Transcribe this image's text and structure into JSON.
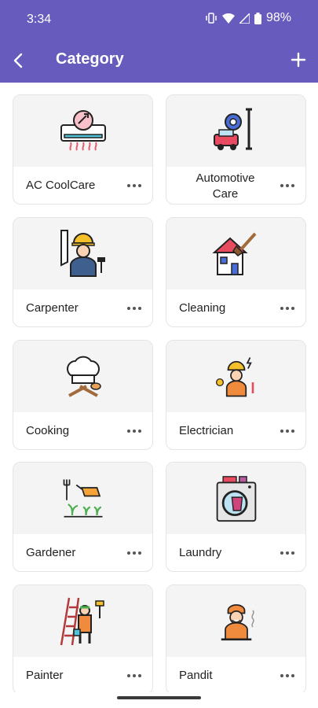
{
  "status": {
    "time": "3:34",
    "battery": "98%"
  },
  "header": {
    "title": "Category",
    "back_icon": "back-arrow-icon",
    "add_icon": "plus-icon"
  },
  "categories": [
    {
      "label": "AC CoolCare",
      "icon": "ac-repair-icon"
    },
    {
      "label": "Automotive Care",
      "icon": "automotive-icon"
    },
    {
      "label": "Carpenter",
      "icon": "carpenter-icon"
    },
    {
      "label": "Cleaning",
      "icon": "cleaning-house-icon"
    },
    {
      "label": "Cooking",
      "icon": "chef-hat-icon"
    },
    {
      "label": "Electrician",
      "icon": "electrician-icon"
    },
    {
      "label": "Gardener",
      "icon": "gardening-icon"
    },
    {
      "label": "Laundry",
      "icon": "washing-machine-icon"
    },
    {
      "label": "Painter",
      "icon": "painter-icon"
    },
    {
      "label": "Pandit",
      "icon": "pandit-icon"
    }
  ]
}
